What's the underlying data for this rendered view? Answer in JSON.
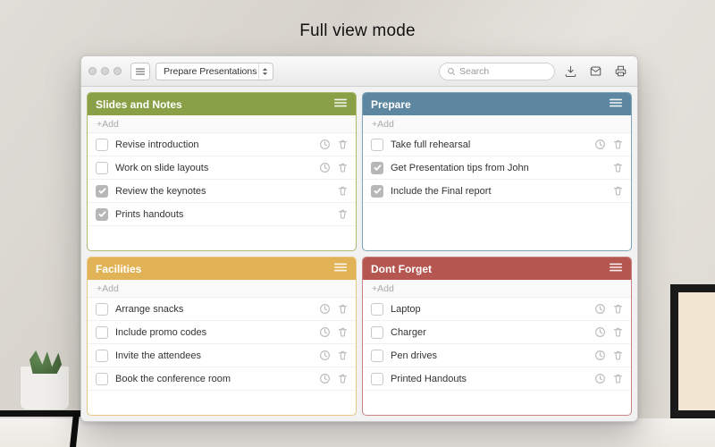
{
  "caption": "Full view mode",
  "toolbar": {
    "project": "Prepare Presentations",
    "search_placeholder": "Search"
  },
  "boards": [
    {
      "title": "Slides and Notes",
      "color_header": "#89a046",
      "color_border": "#a9bb6d",
      "add_label": "+Add",
      "tasks": [
        {
          "text": "Revise introduction",
          "done": false,
          "show_clock": true
        },
        {
          "text": "Work on slide layouts",
          "done": false,
          "show_clock": true
        },
        {
          "text": "Review the keynotes",
          "done": true,
          "show_clock": false
        },
        {
          "text": "Prints handouts",
          "done": true,
          "show_clock": false
        }
      ]
    },
    {
      "title": "Prepare",
      "color_header": "#5d87a0",
      "color_border": "#7fa4b9",
      "add_label": "+Add",
      "tasks": [
        {
          "text": "Take full rehearsal",
          "done": false,
          "show_clock": true
        },
        {
          "text": "Get Presentation tips from John",
          "done": true,
          "show_clock": false
        },
        {
          "text": "Include the Final report",
          "done": true,
          "show_clock": false
        }
      ]
    },
    {
      "title": "Facilities",
      "color_header": "#e2b356",
      "color_border": "#e8c884",
      "add_label": "+Add",
      "tasks": [
        {
          "text": "Arrange snacks",
          "done": false,
          "show_clock": true
        },
        {
          "text": "Include promo codes",
          "done": false,
          "show_clock": true
        },
        {
          "text": "Invite the attendees",
          "done": false,
          "show_clock": true
        },
        {
          "text": "Book the conference room",
          "done": false,
          "show_clock": true
        }
      ]
    },
    {
      "title": "Dont Forget",
      "color_header": "#b55651",
      "color_border": "#c98581",
      "add_label": "+Add",
      "tasks": [
        {
          "text": "Laptop",
          "done": false,
          "show_clock": true
        },
        {
          "text": "Charger",
          "done": false,
          "show_clock": true
        },
        {
          "text": "Pen drives",
          "done": false,
          "show_clock": true
        },
        {
          "text": "Printed Handouts",
          "done": false,
          "show_clock": true
        }
      ]
    }
  ]
}
